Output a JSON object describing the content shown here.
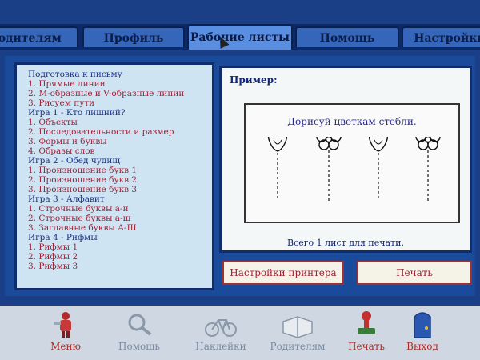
{
  "tabs": [
    {
      "label": "Родителям",
      "active": false
    },
    {
      "label": "Профиль",
      "active": false
    },
    {
      "label": "Рабочие листы",
      "active": true
    },
    {
      "label": "Помощь",
      "active": false
    },
    {
      "label": "Настройки",
      "active": false
    }
  ],
  "lessons": [
    {
      "text": "Подготовка к письму",
      "kind": "head"
    },
    {
      "text": "1. Прямые линии",
      "kind": "item"
    },
    {
      "text": "2. М-образные и V-образные линии",
      "kind": "item"
    },
    {
      "text": "3. Рисуем пути",
      "kind": "item"
    },
    {
      "text": "Игра 1 - Кто лишний?",
      "kind": "head"
    },
    {
      "text": "1. Объекты",
      "kind": "item"
    },
    {
      "text": "2. Последовательности и размер",
      "kind": "item"
    },
    {
      "text": "3. Формы и буквы",
      "kind": "item"
    },
    {
      "text": "4. Образы слов",
      "kind": "item"
    },
    {
      "text": "Игра 2 - Обед чудищ",
      "kind": "head"
    },
    {
      "text": "1. Произношение букв 1",
      "kind": "item"
    },
    {
      "text": "2. Произношение букв 2",
      "kind": "item"
    },
    {
      "text": "3. Произношение букв 3",
      "kind": "item"
    },
    {
      "text": "Игра 3 - Алфавит",
      "kind": "head"
    },
    {
      "text": "1. Строчные буквы а-и",
      "kind": "item"
    },
    {
      "text": "2. Строчные буквы а-ш",
      "kind": "item"
    },
    {
      "text": "3. Заглавные буквы А-Ш",
      "kind": "item"
    },
    {
      "text": "Игра 4 - Рифмы",
      "kind": "head"
    },
    {
      "text": "1. Рифмы 1",
      "kind": "item"
    },
    {
      "text": "2. Рифмы 2",
      "kind": "item"
    },
    {
      "text": "3. Рифмы 3",
      "kind": "item"
    }
  ],
  "preview": {
    "label": "Пример:",
    "worksheet_title": "Дорисуй цветкам стебли.",
    "sheets_note": "Всего 1 лист для печати."
  },
  "buttons": {
    "printer_settings": "Настройки принтера",
    "print": "Печать"
  },
  "toolbar": [
    {
      "label": "Меню",
      "icon": "menu-figure-icon",
      "color": "#b02a2a"
    },
    {
      "label": "Помощь",
      "icon": "magnifier-icon",
      "color": "#7a8aa0"
    },
    {
      "label": "Наклейки",
      "icon": "bicycle-icon",
      "color": "#7a8aa0"
    },
    {
      "label": "Родителям",
      "icon": "book-icon",
      "color": "#7a8aa0"
    },
    {
      "label": "Печать",
      "icon": "stamp-icon",
      "color": "#b02a2a"
    },
    {
      "label": "Выход",
      "icon": "door-icon",
      "color": "#b02a2a"
    }
  ],
  "colors": {
    "heading_text": "#1a2f8a",
    "item_text": "#a32036",
    "panel_border": "#0f2d6e"
  }
}
